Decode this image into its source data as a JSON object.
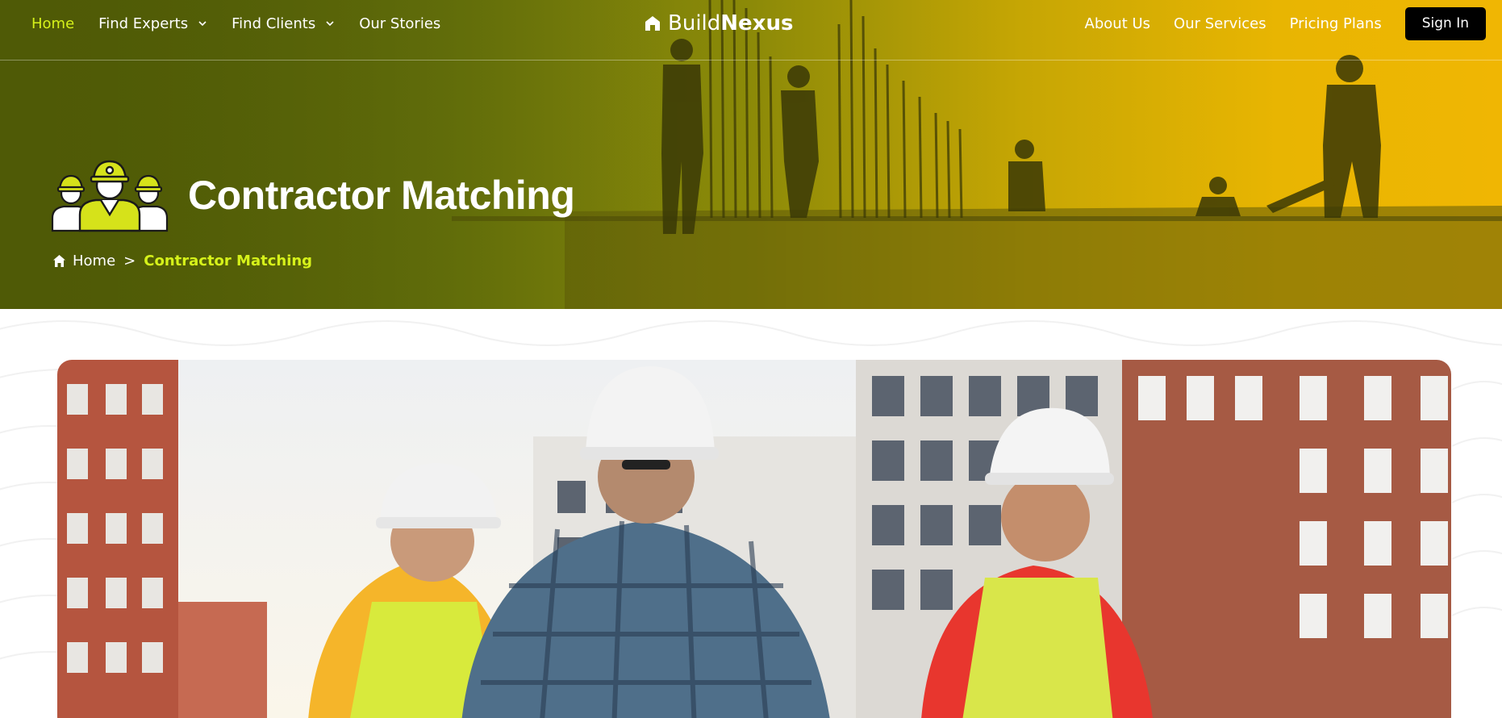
{
  "nav": {
    "left": [
      {
        "label": "Home",
        "active": true,
        "dropdown": false
      },
      {
        "label": "Find Experts",
        "active": false,
        "dropdown": true
      },
      {
        "label": "Find Clients",
        "active": false,
        "dropdown": true
      },
      {
        "label": "Our Stories",
        "active": false,
        "dropdown": false
      }
    ],
    "brand": {
      "part1": "Build",
      "part2": "Nexus",
      "icon": "house-icon"
    },
    "right": [
      {
        "label": "About Us"
      },
      {
        "label": "Our Services"
      },
      {
        "label": "Pricing Plans"
      }
    ],
    "signin_label": "Sign In"
  },
  "hero": {
    "icon": "workers-team-icon",
    "title": "Contractor Matching",
    "breadcrumb": {
      "home_label": "Home",
      "home_icon": "home-icon",
      "separator": ">",
      "current": "Contractor Matching"
    }
  },
  "colors": {
    "accent": "#d6f21a",
    "hero_dark": "#5a6408",
    "hero_light": "#f0b603",
    "signin_bg": "#000000"
  }
}
